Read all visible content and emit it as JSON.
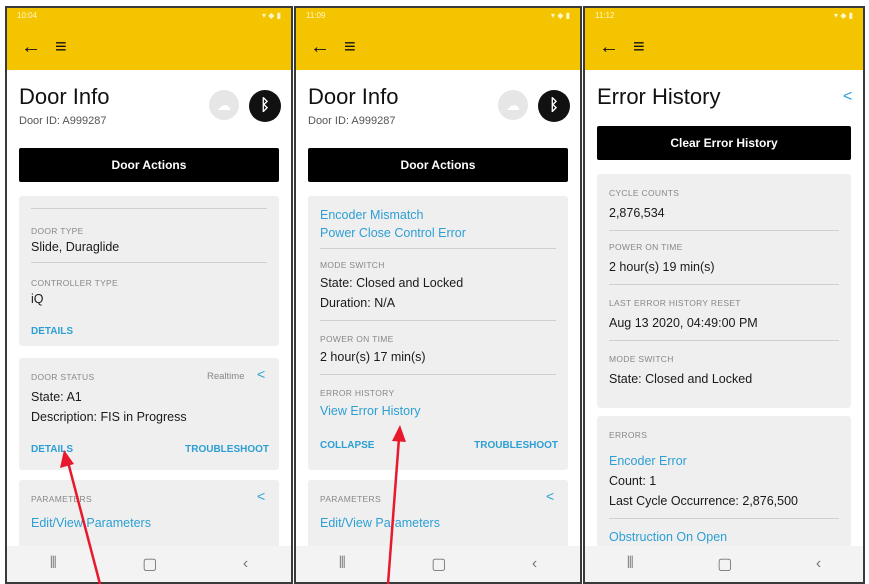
{
  "panel1": {
    "status_time": "10:04",
    "title": "Door Info",
    "door_id": "Door ID: A999287",
    "door_actions": "Door Actions",
    "door_type_caption": "DOOR TYPE",
    "door_type_value": "Slide, Duraglide",
    "controller_type_caption": "CONTROLLER TYPE",
    "controller_type_value": "iQ",
    "details_1": "DETAILS",
    "door_status_caption": "DOOR STATUS",
    "realtime_label": "Realtime",
    "state": "State: A1",
    "description": "Description: FIS in Progress",
    "details_2": "DETAILS",
    "troubleshoot": "TROUBLESHOOT",
    "parameters_caption": "PARAMETERS",
    "edit_parameters": "Edit/View Parameters"
  },
  "panel2": {
    "status_time": "11:09",
    "title": "Door Info",
    "door_id": "Door ID: A999287",
    "door_actions": "Door Actions",
    "error_1": "Encoder Mismatch",
    "error_2": "Power Close Control Error",
    "mode_switch_caption": "MODE SWITCH",
    "mode_state": "State: Closed and Locked",
    "mode_duration": "Duration: N/A",
    "power_on_caption": "POWER ON TIME",
    "power_on_value": "2 hour(s) 17 min(s)",
    "error_history_caption": "ERROR HISTORY",
    "view_error_history": "View Error History",
    "collapse": "COLLAPSE",
    "troubleshoot": "TROUBLESHOOT",
    "parameters_caption": "PARAMETERS",
    "edit_parameters": "Edit/View Parameters"
  },
  "panel3": {
    "status_time": "11:12",
    "title": "Error History",
    "clear_button": "Clear Error History",
    "cycle_counts_caption": "CYCLE COUNTS",
    "cycle_counts_value": "2,876,534",
    "power_on_caption": "POWER ON TIME",
    "power_on_value": "2 hour(s) 19 min(s)",
    "last_reset_caption": "LAST ERROR HISTORY RESET",
    "last_reset_value": "Aug 13 2020, 04:49:00 PM",
    "mode_switch_caption": "MODE SWITCH",
    "mode_state": "State: Closed and Locked",
    "errors_caption": "ERRORS",
    "error_1_name": "Encoder Error",
    "error_1_count": "Count: 1",
    "error_1_last": "Last Cycle Occurrence: 2,876,500",
    "error_2_name": "Obstruction On Open"
  },
  "icons": {
    "back": "back-arrow-icon",
    "menu": "hamburger-menu-icon",
    "share": "share-icon",
    "bluetooth": "bluetooth-icon",
    "cloud": "cloud-icon"
  },
  "colors": {
    "app_bar": "#f5c400",
    "link": "#2d9fd4",
    "action_button": "#000000",
    "annotation_arrow": "#e8192c"
  }
}
